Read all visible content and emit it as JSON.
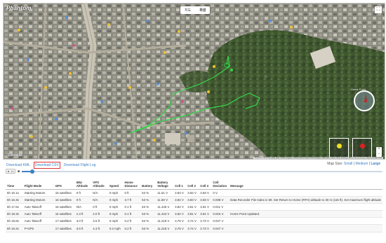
{
  "map": {
    "logo_text": "Phantom",
    "view_tabs": [
      "지도",
      "위성"
    ],
    "active_view": "위성",
    "fullscreen_icon": "fullscreen-icon",
    "zoom_in": "+",
    "zoom_out": "−",
    "home_point_label": "Home Point",
    "google_label": "Google",
    "attribution": "Keyboard shortcuts | Map data ©2023 Imagery ©2023 Airbus, Maxar Technologies, Map data ©2023 TMap Mobility | 50 m | Terms of Use | Report a map error",
    "path_color": "#35d64a",
    "stick_colors": [
      "#f0e020",
      "#e02020"
    ]
  },
  "downloads": {
    "kml": "Download KML",
    "csv": "Download CSV",
    "flight_log": "Download Flight Log"
  },
  "map_size": {
    "label": "Map Size:",
    "small": "Small",
    "medium": "Medium",
    "large": "Large",
    "selected": "Large"
  },
  "playback": {
    "play_label": "► 1x",
    "step_label": "■",
    "progress": 0.03
  },
  "table": {
    "headers": [
      "Time",
      "Flight Mode",
      "GPS",
      "IMU Altitude",
      "VPS Altitude",
      "Speed",
      "Home Distance",
      "Battery",
      "Battery Voltage",
      "Cell 1",
      "Cell 2",
      "Cell 3",
      "Cell Deviation",
      "Message"
    ],
    "rows": [
      [
        "5h 16.1s",
        "Starting Motors",
        "15 satellites",
        "0 ft",
        "N/A",
        "0 mph",
        "0 ft",
        "53 %",
        "11.51 V",
        "3.83 V",
        "3.83 V",
        "3.83 V",
        "0 V",
        ""
      ],
      [
        "5h 16.3s",
        "Starting Motors",
        "16 satellites",
        "0 ft",
        "N/A",
        "0 mph",
        "3.7 ft",
        "53 %",
        "11.50 V",
        "3.84 V",
        "3.83 V",
        "3.83 V",
        "0.008 V",
        "Data Recorder File Index is 59. Set Return to Home (RTH) altitude to 30 m (115 ft). Set maximum flight altitude"
      ],
      [
        "5h 17.6s",
        "Auto Takeoff",
        "16 satellites",
        "N/A",
        "0 ft",
        "0 mph",
        "0.1 ft",
        "53 %",
        "11.445 V",
        "3.82 V",
        "3.81 V",
        "3.81 V",
        "0.011 V",
        ""
      ],
      [
        "5h 18.3s",
        "Auto Takeoff",
        "16 satellites",
        "1.3 ft",
        "2.0 ft",
        "0 mph",
        "0.1 ft",
        "53 %",
        "11.444 V",
        "3.82 V",
        "3.81 V",
        "3.81 V",
        "0.015 V",
        "Home Point Updated."
      ],
      [
        "5h 18.8s",
        "Auto Takeoff",
        "17 satellites",
        "3.0 ft",
        "3.5 ft",
        "0 mph",
        "0.2 ft",
        "53 %",
        "11.218 V",
        "3.75 V",
        "3.74 V",
        "3.73 V",
        "0.027 V",
        ""
      ],
      [
        "5h 19.2s",
        "P-GPS",
        "17 satellites",
        "3.6 ft",
        "4.3 ft",
        "0.2 mph",
        "0.2 ft",
        "53 %",
        "11.218 V",
        "3.75 V",
        "3.74 V",
        "3.73 V",
        "0.027 V",
        ""
      ]
    ]
  }
}
